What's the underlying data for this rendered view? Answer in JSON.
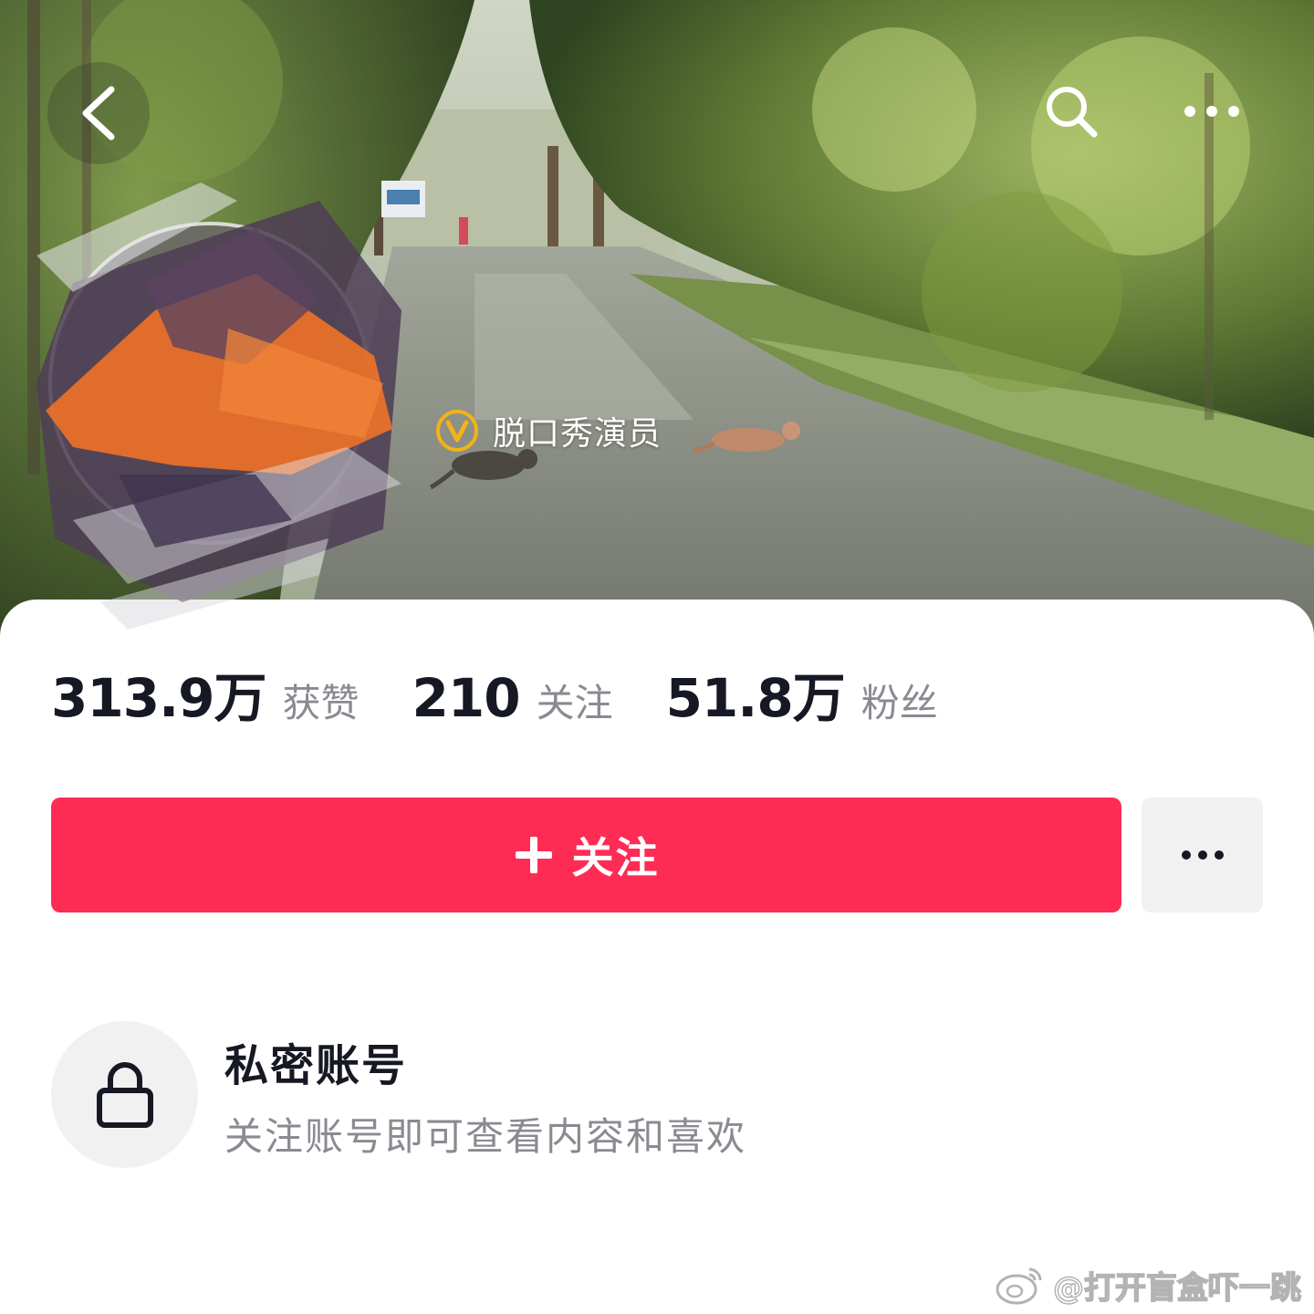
{
  "header": {
    "back_icon": "chevron-left-icon",
    "search_icon": "search-icon",
    "more_icon": "ellipsis-icon",
    "verified_icon": "verified-v-badge-icon",
    "verified_label": "脱口秀演员"
  },
  "stats": [
    {
      "value": "313.9万",
      "label": "获赞"
    },
    {
      "value": "210",
      "label": "关注"
    },
    {
      "value": "51.8万",
      "label": "粉丝"
    }
  ],
  "actions": {
    "follow_label": "关注",
    "follow_icon": "plus-icon",
    "more_icon": "ellipsis-icon"
  },
  "private": {
    "icon": "lock-icon",
    "title": "私密账号",
    "description": "关注账号即可查看内容和喜欢"
  },
  "watermark": {
    "icon": "weibo-logo-icon",
    "text": "@打开盲盒吓一跳"
  },
  "colors": {
    "accent": "#fe2c55",
    "primary_text": "#161823",
    "secondary_text": "#8a8b91",
    "neutral_button": "#f1f1f2",
    "verified_gold": "#f3b21b"
  }
}
